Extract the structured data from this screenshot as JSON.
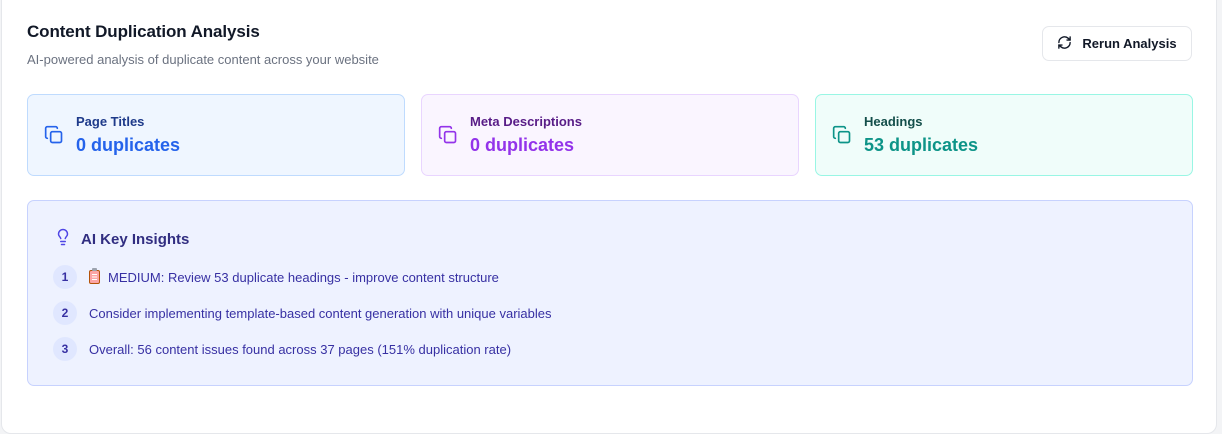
{
  "header": {
    "title": "Content Duplication Analysis",
    "subtitle": "AI-powered analysis of duplicate content across your website",
    "rerun_label": "Rerun Analysis"
  },
  "stats": [
    {
      "label": "Page Titles",
      "value": "0 duplicates",
      "color": "#2563eb",
      "icon": "copy-icon"
    },
    {
      "label": "Meta Descriptions",
      "value": "0 duplicates",
      "color": "#9333ea",
      "icon": "copy-icon"
    },
    {
      "label": "Headings",
      "value": "53 duplicates",
      "color": "#0d9488",
      "icon": "copy-icon"
    }
  ],
  "insights": {
    "title": "AI Key Insights",
    "icon": "lightbulb-icon",
    "items": [
      {
        "num": "1",
        "text": "MEDIUM: Review 53 duplicate headings - improve content structure",
        "icon": "clipboard-icon"
      },
      {
        "num": "2",
        "text": "Consider implementing template-based content generation with unique variables"
      },
      {
        "num": "3",
        "text": "Overall: 56 content issues found across 37 pages (151% duplication rate)"
      }
    ]
  }
}
